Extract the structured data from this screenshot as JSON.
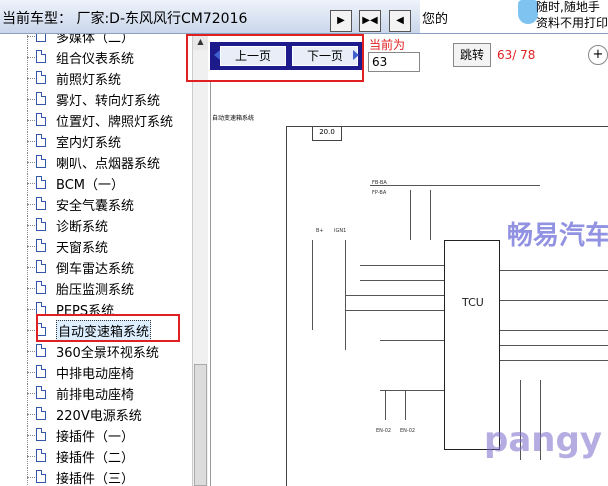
{
  "header": {
    "title": "当前车型：  厂家:D-东风风行CM72016",
    "btn_prev_sym": "▶",
    "btn_mid_sym": "▶◀",
    "btn_next_sym": "◀",
    "note": "您的",
    "ad_line1": "随时,随地手",
    "ad_line2": "资料不用打印"
  },
  "sidebar": {
    "items": [
      {
        "label": "多媒体（二）"
      },
      {
        "label": "组合仪表系统"
      },
      {
        "label": "前照灯系统"
      },
      {
        "label": "雾灯、转向灯系统"
      },
      {
        "label": "位置灯、牌照灯系统"
      },
      {
        "label": "室内灯系统"
      },
      {
        "label": "喇叭、点烟器系统"
      },
      {
        "label": "BCM（一）"
      },
      {
        "label": "安全气囊系统"
      },
      {
        "label": "诊断系统"
      },
      {
        "label": "天窗系统"
      },
      {
        "label": "倒车雷达系统"
      },
      {
        "label": "胎压监测系统"
      },
      {
        "label": "PEPS系统"
      },
      {
        "label": "自动变速箱系统"
      },
      {
        "label": "360全景环视系统"
      },
      {
        "label": "中排电动座椅"
      },
      {
        "label": "前排电动座椅"
      },
      {
        "label": "220V电源系统"
      },
      {
        "label": "接插件（一）"
      },
      {
        "label": "接插件（二）"
      },
      {
        "label": "接插件（三）"
      }
    ],
    "selected_index": 14
  },
  "nav": {
    "prev_label": "上一页",
    "next_label": "下一页",
    "current_label": "当前为",
    "current_value": "63",
    "jump_label": "跳转",
    "page_count": "63/ 78",
    "zoom_symbol": "+"
  },
  "document": {
    "heading": "自动变速箱系统",
    "tab": "20.0",
    "tcu_label": "TCU",
    "watermark1": "畅易汽车",
    "watermark2": "pangy",
    "labels": [
      "B+",
      "IGN1",
      "FB-BA",
      "FP-BA",
      "EN-02",
      "EN-02",
      "TCU"
    ]
  },
  "colors": {
    "accent_red": "#e02020",
    "nav_panel": "#1d1a8c",
    "watermark_blue": "#3a3acc"
  }
}
